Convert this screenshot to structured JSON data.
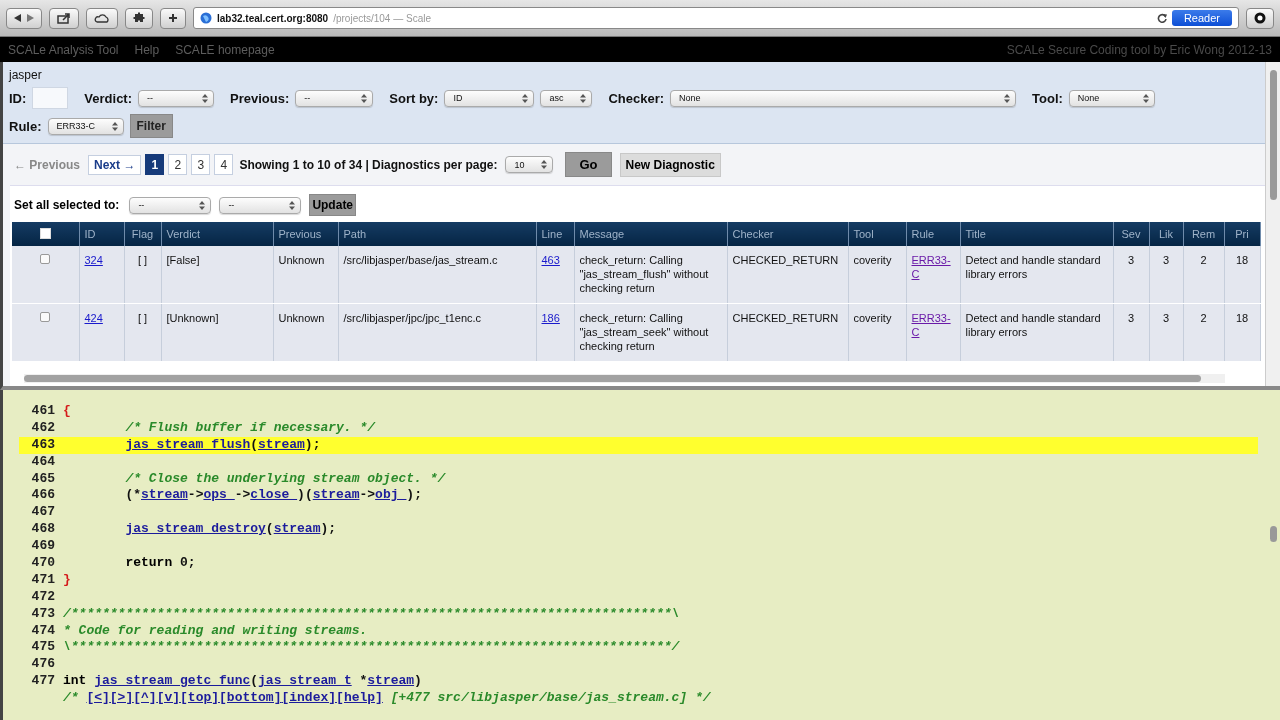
{
  "browser": {
    "url_host": "lab32.teal.cert.org:8080",
    "url_rest": "/projects/104 — Scale",
    "reader": "Reader"
  },
  "nav": {
    "links": [
      "SCALe Analysis Tool",
      "Help",
      "SCALE homepage"
    ],
    "credit": "SCALe Secure Coding tool by Eric Wong 2012-13"
  },
  "filters": {
    "project": "jasper",
    "rows": [
      [
        {
          "kind": "text",
          "label": "ID:"
        },
        {
          "kind": "select",
          "label": "Verdict:",
          "value": "--"
        },
        {
          "kind": "select",
          "label": "Previous:",
          "value": "--"
        },
        {
          "kind": "select",
          "label": "Sort by:",
          "value": "ID"
        },
        {
          "kind": "select",
          "value": "asc"
        },
        {
          "kind": "select",
          "label": "Checker:",
          "value": "None"
        },
        {
          "kind": "select",
          "label": "Tool:",
          "value": "None"
        }
      ],
      [
        {
          "kind": "select",
          "label": "Rule:",
          "value": "ERR33-C"
        },
        {
          "kind": "button",
          "value": "Filter"
        }
      ]
    ]
  },
  "pagination": {
    "previous": {
      "label": "← Previous",
      "disabled": true
    },
    "next": {
      "label": "Next →",
      "disabled": false
    },
    "pages": [
      {
        "label": "1",
        "selected": true
      },
      {
        "label": "2",
        "selected": false
      },
      {
        "label": "3",
        "selected": false
      },
      {
        "label": "4",
        "selected": false
      }
    ],
    "summary": "Showing 1 to 10 of 34 | Diagnostics per page:",
    "per_page": "10",
    "go": "Go",
    "new_diagnostic": "New Diagnostic"
  },
  "bulk": {
    "label": "Set all selected to:",
    "selects": [
      "--",
      "--"
    ],
    "button": "Update"
  },
  "table": {
    "header_checked": false,
    "columns": [
      {
        "label": "ID",
        "kind": "link"
      },
      {
        "label": "Flag",
        "kind": "center"
      },
      {
        "label": "Verdict",
        "kind": "text"
      },
      {
        "label": "Previous",
        "kind": "text"
      },
      {
        "label": "Path",
        "kind": "text"
      },
      {
        "label": "Line",
        "kind": "link"
      },
      {
        "label": "Message",
        "kind": "text"
      },
      {
        "label": "Checker",
        "kind": "text"
      },
      {
        "label": "Tool",
        "kind": "text"
      },
      {
        "label": "Rule",
        "kind": "visited"
      },
      {
        "label": "Title",
        "kind": "text"
      },
      {
        "label": "Sev",
        "kind": "center"
      },
      {
        "label": "Lik",
        "kind": "center"
      },
      {
        "label": "Rem",
        "kind": "center"
      },
      {
        "label": "Pri",
        "kind": "center"
      }
    ],
    "rows": [
      {
        "checked": false,
        "cells": [
          "324",
          "[ ]",
          "[False]",
          "Unknown",
          "/src/libjasper/base/jas_stream.c",
          "463",
          "check_return: Calling \"jas_stream_flush\" without checking return",
          "CHECKED_RETURN",
          "coverity",
          "ERR33-C",
          "Detect and handle standard library errors",
          "3",
          "3",
          "2",
          "18"
        ]
      },
      {
        "checked": false,
        "cells": [
          "424",
          "[ ]",
          "[Unknown]",
          "Unknown",
          "/src/libjasper/jpc/jpc_t1enc.c",
          "186",
          "check_return: Calling \"jas_stream_seek\" without checking return",
          "CHECKED_RETURN",
          "coverity",
          "ERR33-C",
          "Detect and handle standard library errors",
          "3",
          "3",
          "2",
          "18"
        ]
      }
    ]
  },
  "code": {
    "lines": [
      {
        "num": "461",
        "highlighted": false,
        "indented": false,
        "segments": [
          {
            "t": "{",
            "kind": "brace"
          }
        ]
      },
      {
        "num": "462",
        "highlighted": false,
        "indented": true,
        "segments": [
          {
            "t": "/* Flush buffer if necessary. */",
            "kind": "comment"
          }
        ]
      },
      {
        "num": "463",
        "highlighted": true,
        "indented": true,
        "segments": [
          {
            "t": "jas_stream_flush",
            "kind": "link"
          },
          {
            "t": "(",
            "kind": "plain"
          },
          {
            "t": "stream",
            "kind": "link"
          },
          {
            "t": ");",
            "kind": "plain"
          }
        ]
      },
      {
        "num": "464",
        "highlighted": false
      },
      {
        "num": "465",
        "highlighted": false,
        "indented": true,
        "segments": [
          {
            "t": "/* Close the underlying stream object. */",
            "kind": "comment"
          }
        ]
      },
      {
        "num": "466",
        "highlighted": false,
        "indented": true,
        "segments": [
          {
            "t": "(*",
            "kind": "plain"
          },
          {
            "t": "stream",
            "kind": "link"
          },
          {
            "t": "->",
            "kind": "plain"
          },
          {
            "t": "ops_",
            "kind": "link"
          },
          {
            "t": "->",
            "kind": "plain"
          },
          {
            "t": "close_",
            "kind": "link"
          },
          {
            "t": ")(",
            "kind": "plain"
          },
          {
            "t": "stream",
            "kind": "link"
          },
          {
            "t": "->",
            "kind": "plain"
          },
          {
            "t": "obj_",
            "kind": "link"
          },
          {
            "t": ");",
            "kind": "plain"
          }
        ]
      },
      {
        "num": "467",
        "highlighted": false
      },
      {
        "num": "468",
        "highlighted": false,
        "indented": true,
        "segments": [
          {
            "t": "jas_stream_destroy",
            "kind": "link"
          },
          {
            "t": "(",
            "kind": "plain"
          },
          {
            "t": "stream",
            "kind": "link"
          },
          {
            "t": ");",
            "kind": "plain"
          }
        ]
      },
      {
        "num": "469",
        "highlighted": false
      },
      {
        "num": "470",
        "highlighted": false,
        "indented": true,
        "segments": [
          {
            "t": "return",
            "kind": "keyword"
          },
          {
            "t": " 0;",
            "kind": "plain"
          }
        ]
      },
      {
        "num": "471",
        "highlighted": false,
        "indented": false,
        "segments": [
          {
            "t": "}",
            "kind": "brace"
          }
        ]
      },
      {
        "num": "472",
        "highlighted": false
      },
      {
        "num": "473",
        "highlighted": false,
        "indented": false,
        "segments": [
          {
            "t": "/*****************************************************************************\\",
            "kind": "comment"
          }
        ]
      },
      {
        "num": "474",
        "highlighted": false,
        "indented": false,
        "segments": [
          {
            "t": "* Code for reading and writing streams.",
            "kind": "comment"
          }
        ]
      },
      {
        "num": "475",
        "highlighted": false,
        "indented": false,
        "segments": [
          {
            "t": "\\*****************************************************************************/",
            "kind": "comment"
          }
        ]
      },
      {
        "num": "476",
        "highlighted": false
      },
      {
        "num": "477",
        "highlighted": false,
        "indented": false,
        "segments": [
          {
            "t": "int ",
            "kind": "keyword"
          },
          {
            "t": "jas_stream_getc_func",
            "kind": "link"
          },
          {
            "t": "(",
            "kind": "plain"
          },
          {
            "t": "jas_stream_t",
            "kind": "link"
          },
          {
            "t": " *",
            "kind": "plain"
          },
          {
            "t": "stream",
            "kind": "link"
          },
          {
            "t": ")",
            "kind": "plain"
          }
        ]
      },
      {
        "highlighted": false,
        "indented": false,
        "segments": [
          {
            "t": "/* ",
            "kind": "comment"
          },
          {
            "t": "[<]",
            "kind": "link"
          },
          {
            "t": "[>]",
            "kind": "link"
          },
          {
            "t": "[^]",
            "kind": "link"
          },
          {
            "t": "[v]",
            "kind": "link"
          },
          {
            "t": "[top]",
            "kind": "link"
          },
          {
            "t": "[bottom]",
            "kind": "link"
          },
          {
            "t": "[index]",
            "kind": "link"
          },
          {
            "t": "[help]",
            "kind": "link"
          },
          {
            "t": " [+477 src/libjasper/base/jas_stream.c] */",
            "kind": "comment"
          }
        ]
      }
    ]
  }
}
